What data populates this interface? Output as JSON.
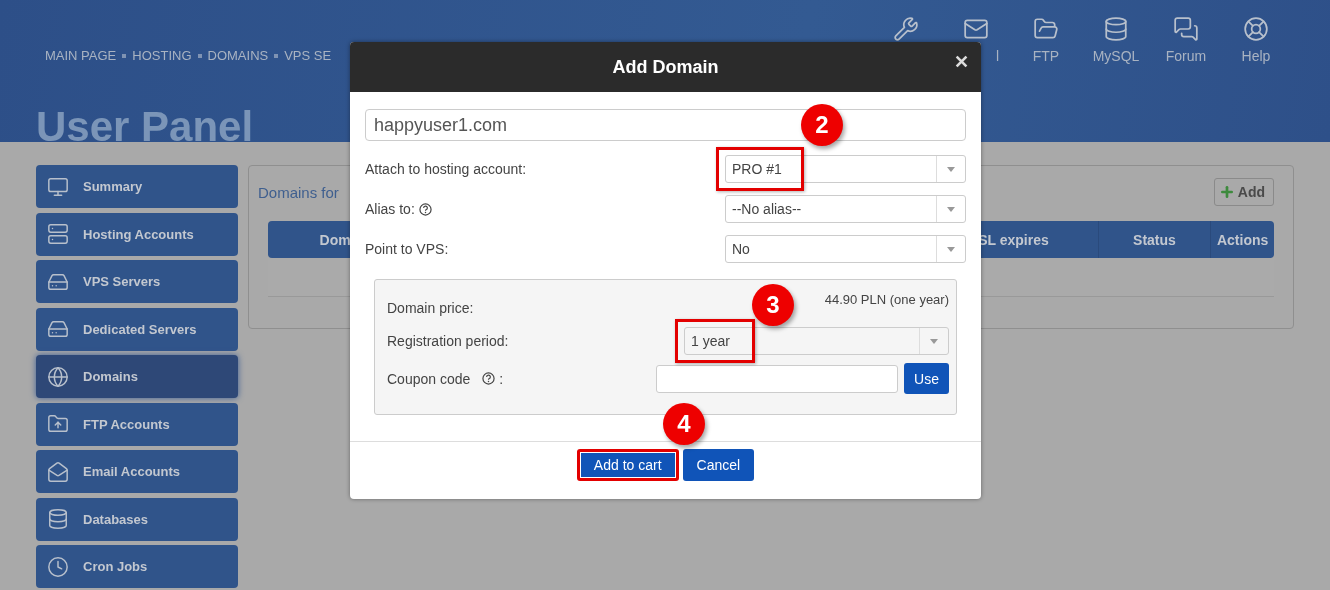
{
  "breadcrumb": [
    "MAIN PAGE",
    "HOSTING",
    "DOMAINS",
    "VPS SE"
  ],
  "top_nav": [
    {
      "label": "l"
    },
    {
      "label": "FTP"
    },
    {
      "label": "MySQL"
    },
    {
      "label": "Forum"
    },
    {
      "label": "Help"
    }
  ],
  "page_title": "User Panel",
  "sidebar": {
    "items": [
      {
        "label": "Summary",
        "selected": false
      },
      {
        "label": "Hosting Accounts",
        "selected": false
      },
      {
        "label": "VPS Servers",
        "selected": false
      },
      {
        "label": "Dedicated Servers",
        "selected": false
      },
      {
        "label": "Domains",
        "selected": true
      },
      {
        "label": "FTP Accounts",
        "selected": false
      },
      {
        "label": "Email Accounts",
        "selected": false
      },
      {
        "label": "Databases",
        "selected": false
      },
      {
        "label": "Cron Jobs",
        "selected": false
      }
    ]
  },
  "panel": {
    "title": "Domains for",
    "add_button": "Add",
    "table": {
      "columns": [
        "Dom",
        "SL expires",
        "Status",
        "Actions"
      ]
    }
  },
  "dialog": {
    "title": "Add Domain",
    "close": "✕",
    "domain_value": "happyuser1.com",
    "fields": [
      {
        "label": "Attach to hosting account:",
        "value": "PRO #1",
        "help": false,
        "highlighted": true
      },
      {
        "label": "Alias to:",
        "value": "--No alias--",
        "help": true,
        "highlighted": false
      },
      {
        "label": "Point to VPS:",
        "value": "No",
        "help": false,
        "highlighted": false
      }
    ],
    "price": {
      "label": "Domain price:",
      "value": "44.90 PLN (one year)"
    },
    "period": {
      "label": "Registration period:",
      "value": "1 year",
      "highlighted": true
    },
    "coupon": {
      "label": "Coupon code",
      "suffix": ":",
      "button": "Use"
    },
    "buttons": [
      {
        "label": "Add to cart",
        "highlighted": true
      },
      {
        "label": "Cancel",
        "highlighted": false
      }
    ],
    "markers": [
      "2",
      "3",
      "4"
    ]
  }
}
